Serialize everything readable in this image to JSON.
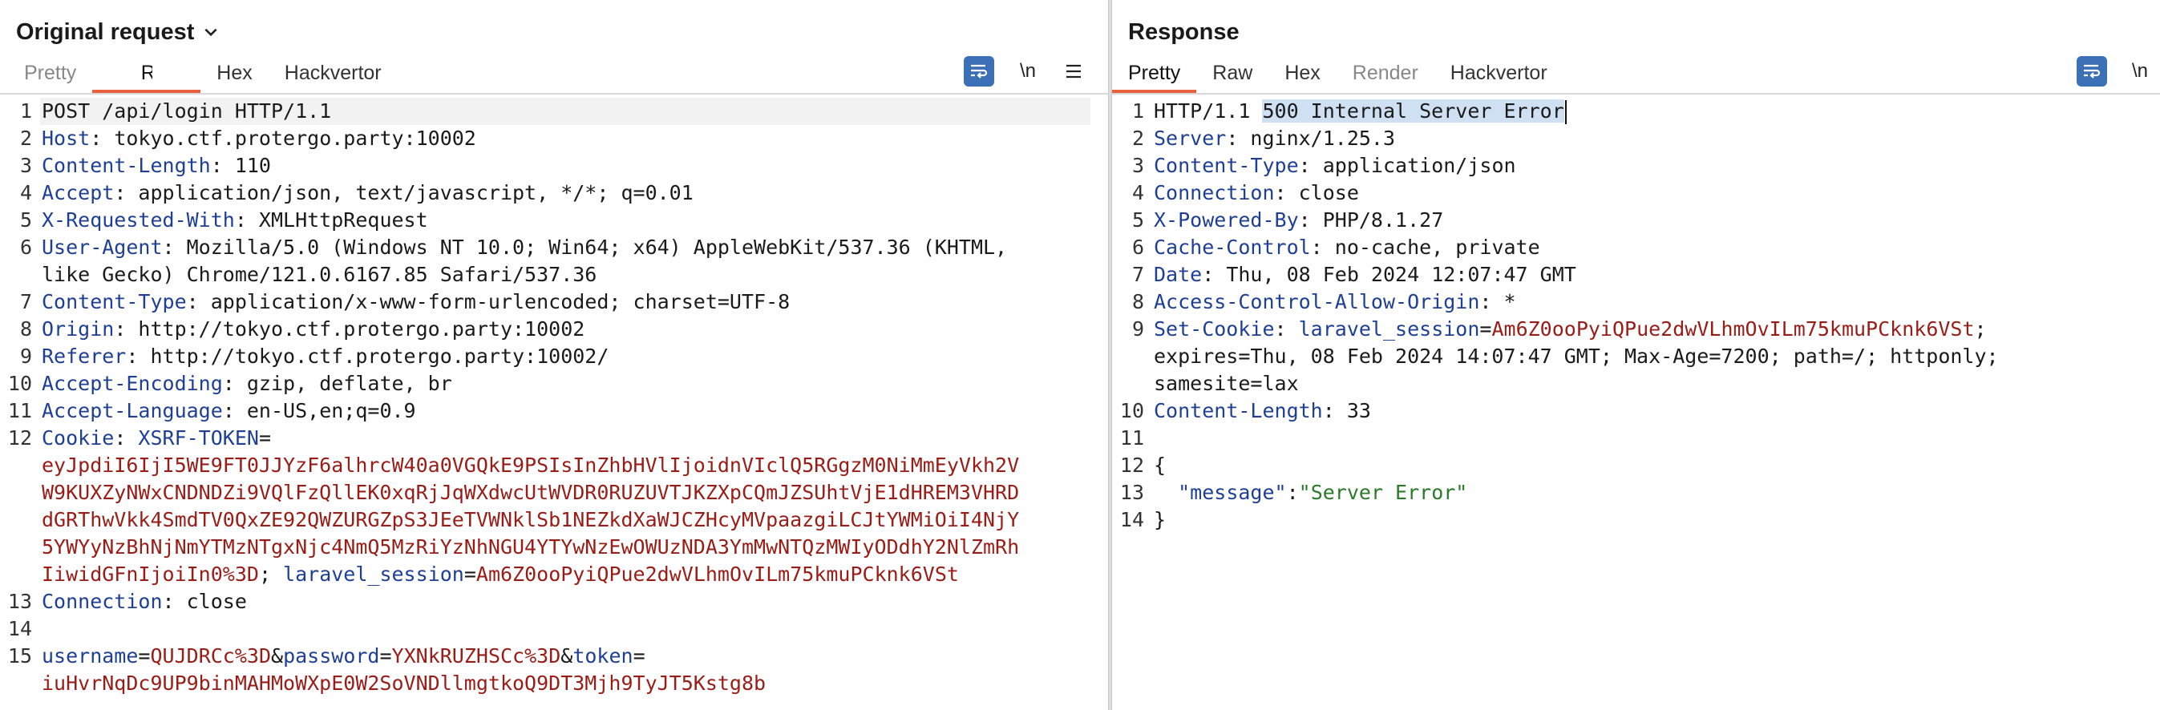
{
  "left": {
    "title": "Original request",
    "tabs": [
      {
        "label": "Pretty",
        "state": "dim"
      },
      {
        "label": "Raw",
        "state": "active"
      },
      {
        "label": "Hex",
        "state": "normal"
      },
      {
        "label": "Hackvertor",
        "state": "normal"
      }
    ],
    "toolbar": {
      "newline_label": "\\n"
    },
    "lines": [
      {
        "n": "1",
        "parts": [
          [
            "t",
            "POST /api/login HTTP/1.1"
          ]
        ]
      },
      {
        "n": "2",
        "parts": [
          [
            "k",
            "Host"
          ],
          [
            "t",
            ": tokyo.ctf.protergo.party:10002"
          ]
        ]
      },
      {
        "n": "3",
        "parts": [
          [
            "k",
            "Content-Length"
          ],
          [
            "t",
            ": 110"
          ]
        ]
      },
      {
        "n": "4",
        "parts": [
          [
            "k",
            "Accept"
          ],
          [
            "t",
            ": application/json, text/javascript, */*; q=0.01"
          ]
        ]
      },
      {
        "n": "5",
        "parts": [
          [
            "k",
            "X-Requested-With"
          ],
          [
            "t",
            ": XMLHttpRequest"
          ]
        ]
      },
      {
        "n": "6",
        "parts": [
          [
            "k",
            "User-Agent"
          ],
          [
            "t",
            ": Mozilla/5.0 (Windows NT 10.0; Win64; x64) AppleWebKit/537.36 (KHTML,"
          ]
        ]
      },
      {
        "n": "",
        "parts": [
          [
            "t",
            "like Gecko) Chrome/121.0.6167.85 Safari/537.36"
          ]
        ]
      },
      {
        "n": "7",
        "parts": [
          [
            "k",
            "Content-Type"
          ],
          [
            "t",
            ": application/x-www-form-urlencoded; charset=UTF-8"
          ]
        ]
      },
      {
        "n": "8",
        "parts": [
          [
            "k",
            "Origin"
          ],
          [
            "t",
            ": http://tokyo.ctf.protergo.party:10002"
          ]
        ]
      },
      {
        "n": "9",
        "parts": [
          [
            "k",
            "Referer"
          ],
          [
            "t",
            ": http://tokyo.ctf.protergo.party:10002/"
          ]
        ]
      },
      {
        "n": "10",
        "parts": [
          [
            "k",
            "Accept-Encoding"
          ],
          [
            "t",
            ": gzip, deflate, br"
          ]
        ]
      },
      {
        "n": "11",
        "parts": [
          [
            "k",
            "Accept-Language"
          ],
          [
            "t",
            ": en-US,en;q=0.9"
          ]
        ]
      },
      {
        "n": "12",
        "parts": [
          [
            "k",
            "Cookie"
          ],
          [
            "t",
            ": "
          ],
          [
            "k",
            "XSRF-TOKEN"
          ],
          [
            "t",
            "="
          ]
        ]
      },
      {
        "n": "",
        "parts": [
          [
            "v",
            "eyJpdiI6IjI5WE9FT0JJYzF6alhrcW40a0VGQkE9PSIsInZhbHVlIjoidnVIclQ5RGgzM0NiMmEyVkh2V"
          ]
        ]
      },
      {
        "n": "",
        "parts": [
          [
            "v",
            "W9KUXZyNWxCNDNDZi9VQlFzQllEK0xqRjJqWXdwcUtWVDR0RUZUVTJKZXpCQmJZSUhtVjE1dHREM3VHRD"
          ]
        ]
      },
      {
        "n": "",
        "parts": [
          [
            "v",
            "dGRThwVkk4SmdTV0QxZE92QWZURGZpS3JEeTVWNklSb1NEZkdXaWJCZHcyMVpaazgiLCJtYWMiOiI4NjY"
          ]
        ]
      },
      {
        "n": "",
        "parts": [
          [
            "v",
            "5YWYyNzBhNjNmYTMzNTgxNjc4NmQ5MzRiYzNhNGU4YTYwNzEwOWUzNDA3YmMwNTQzMWIyODdhY2NlZmRh"
          ]
        ]
      },
      {
        "n": "",
        "parts": [
          [
            "v",
            "IiwidGFnIjoiIn0%3D"
          ],
          [
            "t",
            "; "
          ],
          [
            "k",
            "laravel_session"
          ],
          [
            "t",
            "="
          ],
          [
            "v",
            "Am6Z0ooPyiQPue2dwVLhmOvILm75kmuPCknk6VSt"
          ]
        ]
      },
      {
        "n": "13",
        "parts": [
          [
            "k",
            "Connection"
          ],
          [
            "t",
            ": close"
          ]
        ]
      },
      {
        "n": "14",
        "parts": []
      },
      {
        "n": "15",
        "parts": [
          [
            "k",
            "username"
          ],
          [
            "t",
            "="
          ],
          [
            "v",
            "QUJDRCc%3D"
          ],
          [
            "t",
            "&"
          ],
          [
            "k",
            "password"
          ],
          [
            "t",
            "="
          ],
          [
            "v",
            "YXNkRUZHSCc%3D"
          ],
          [
            "t",
            "&"
          ],
          [
            "k",
            "token"
          ],
          [
            "t",
            "="
          ]
        ]
      },
      {
        "n": "",
        "parts": [
          [
            "v",
            "iuHvrNqDc9UP9binMAHMoWXpE0W2SoVNDllmgtkoQ9DT3Mjh9TyJT5Kstg8b"
          ]
        ]
      }
    ]
  },
  "right": {
    "title": "Response",
    "tabs": [
      {
        "label": "Pretty",
        "state": "active"
      },
      {
        "label": "Raw",
        "state": "normal"
      },
      {
        "label": "Hex",
        "state": "normal"
      },
      {
        "label": "Render",
        "state": "dim"
      },
      {
        "label": "Hackvertor",
        "state": "normal"
      }
    ],
    "toolbar": {
      "newline_label": "\\n"
    },
    "lines": [
      {
        "n": "1",
        "parts": [
          [
            "t",
            "HTTP/1.1 "
          ],
          [
            "h",
            "500 Internal Server Error"
          ],
          [
            "c",
            ""
          ]
        ]
      },
      {
        "n": "2",
        "parts": [
          [
            "k",
            "Server"
          ],
          [
            "t",
            ": nginx/1.25.3"
          ]
        ]
      },
      {
        "n": "3",
        "parts": [
          [
            "k",
            "Content-Type"
          ],
          [
            "t",
            ": application/json"
          ]
        ]
      },
      {
        "n": "4",
        "parts": [
          [
            "k",
            "Connection"
          ],
          [
            "t",
            ": close"
          ]
        ]
      },
      {
        "n": "5",
        "parts": [
          [
            "k",
            "X-Powered-By"
          ],
          [
            "t",
            ": PHP/8.1.27"
          ]
        ]
      },
      {
        "n": "6",
        "parts": [
          [
            "k",
            "Cache-Control"
          ],
          [
            "t",
            ": no-cache, private"
          ]
        ]
      },
      {
        "n": "7",
        "parts": [
          [
            "k",
            "Date"
          ],
          [
            "t",
            ": Thu, 08 Feb 2024 12:07:47 GMT"
          ]
        ]
      },
      {
        "n": "8",
        "parts": [
          [
            "k",
            "Access-Control-Allow-Origin"
          ],
          [
            "t",
            ": *"
          ]
        ]
      },
      {
        "n": "9",
        "parts": [
          [
            "k",
            "Set-Cookie"
          ],
          [
            "t",
            ": "
          ],
          [
            "k",
            "laravel_session"
          ],
          [
            "t",
            "="
          ],
          [
            "v",
            "Am6Z0ooPyiQPue2dwVLhmOvILm75kmuPCknk6VSt"
          ],
          [
            "t",
            ";"
          ]
        ]
      },
      {
        "n": "",
        "parts": [
          [
            "t",
            "expires=Thu, 08 Feb 2024 14:07:47 GMT; Max-Age=7200; path=/; httponly;"
          ]
        ]
      },
      {
        "n": "",
        "parts": [
          [
            "t",
            "samesite=lax"
          ]
        ]
      },
      {
        "n": "10",
        "parts": [
          [
            "k",
            "Content-Length"
          ],
          [
            "t",
            ": 33"
          ]
        ]
      },
      {
        "n": "11",
        "parts": []
      },
      {
        "n": "12",
        "parts": [
          [
            "t",
            "{"
          ]
        ]
      },
      {
        "n": "13",
        "parts": [
          [
            "t",
            "  "
          ],
          [
            "k",
            "\"message\""
          ],
          [
            "t",
            ":"
          ],
          [
            "s",
            "\"Server Error\""
          ]
        ]
      },
      {
        "n": "14",
        "parts": [
          [
            "t",
            "}"
          ]
        ]
      }
    ]
  },
  "colors": {
    "accent": "#e8613c",
    "header_key": "#1e3f94",
    "value_red": "#9a1c16",
    "string_green": "#2a7a2a",
    "highlight": "#cfe0f2",
    "wrap_button": "#3b6fb6"
  }
}
